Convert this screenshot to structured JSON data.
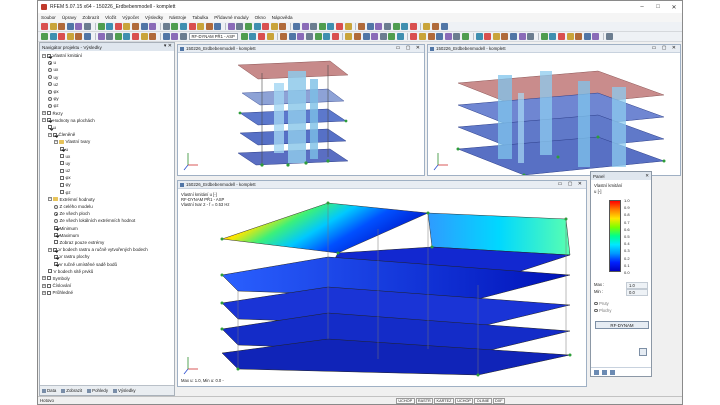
{
  "window": {
    "title": "RFEM 5.07.15 x64 - 150226_Erdbebenmodell - komplett",
    "minimize": "–",
    "maximize": "□",
    "close": "✕"
  },
  "menu": [
    "Soubor",
    "Úpravy",
    "Zobrazit",
    "Vložit",
    "Výpočet",
    "Výsledky",
    "Nástroje",
    "Tabulka",
    "Přídavné moduly",
    "Okno",
    "Nápověda"
  ],
  "toolbar": {
    "combo_case": "RF-DYNAM PŘ1 - ASP"
  },
  "navigator": {
    "title": "Navigátor projektu - Výsledky",
    "controls": "▾ ✕",
    "tabs": [
      "Data",
      "Zobrazit",
      "Pohledy",
      "Výsledky"
    ],
    "tree": [
      {
        "level": 1,
        "type": "check",
        "on": true,
        "expander": "−",
        "label": "Vlastní kmitání"
      },
      {
        "level": 2,
        "type": "radio",
        "on": true,
        "label": "u"
      },
      {
        "level": 2,
        "type": "radio",
        "on": false,
        "label": "ux"
      },
      {
        "level": 2,
        "type": "radio",
        "on": false,
        "label": "uy"
      },
      {
        "level": 2,
        "type": "radio",
        "on": false,
        "label": "uz"
      },
      {
        "level": 2,
        "type": "radio",
        "on": false,
        "label": "φx"
      },
      {
        "level": 2,
        "type": "radio",
        "on": false,
        "label": "φy"
      },
      {
        "level": 2,
        "type": "radio",
        "on": false,
        "label": "φz"
      },
      {
        "level": 1,
        "type": "check",
        "on": false,
        "expander": "+",
        "label": "Řezy"
      },
      {
        "level": 1,
        "type": "check",
        "on": true,
        "expander": "−",
        "label": "Hodnoty na plochách"
      },
      {
        "level": 2,
        "type": "check",
        "on": true,
        "label": "u"
      },
      {
        "level": 2,
        "type": "check",
        "on": true,
        "expander": "−",
        "label": "Členěně"
      },
      {
        "level": 3,
        "type": "folder",
        "on": false,
        "expander": "−",
        "label": "Vlastní tvary"
      },
      {
        "level": 4,
        "type": "check",
        "on": true,
        "label": "u"
      },
      {
        "level": 4,
        "type": "check",
        "on": false,
        "label": "ux"
      },
      {
        "level": 4,
        "type": "check",
        "on": false,
        "label": "uy"
      },
      {
        "level": 4,
        "type": "check",
        "on": false,
        "label": "uz"
      },
      {
        "level": 4,
        "type": "check",
        "on": false,
        "label": "φx"
      },
      {
        "level": 4,
        "type": "check",
        "on": false,
        "label": "φy"
      },
      {
        "level": 4,
        "type": "check",
        "on": false,
        "label": "φz"
      },
      {
        "level": 2,
        "type": "folder",
        "on": false,
        "expander": "−",
        "label": "Extrémní hodnoty"
      },
      {
        "level": 3,
        "type": "radio",
        "on": false,
        "label": "Z celého modelu"
      },
      {
        "level": 3,
        "type": "radio",
        "on": true,
        "label": "Ze všech ploch"
      },
      {
        "level": 3,
        "type": "radio",
        "on": false,
        "label": "Ze všech lokálních extrémních hodnot"
      },
      {
        "level": 3,
        "type": "check",
        "on": true,
        "label": "Minimum"
      },
      {
        "level": 3,
        "type": "check",
        "on": true,
        "label": "Maximum"
      },
      {
        "level": 3,
        "type": "check",
        "on": false,
        "label": "Zobraz pouze extrémy"
      },
      {
        "level": 2,
        "type": "check",
        "on": true,
        "expander": "−",
        "label": "V bodech rastru a ručně vytvořených bodech"
      },
      {
        "level": 3,
        "type": "check",
        "on": true,
        "label": "V rastru plochy"
      },
      {
        "level": 3,
        "type": "check",
        "on": true,
        "label": "V ručně umístěné sadě bodů"
      },
      {
        "level": 2,
        "type": "check",
        "on": false,
        "label": "V bodech sítě prvků"
      },
      {
        "level": 1,
        "type": "check",
        "on": false,
        "expander": "+",
        "label": "Symboly"
      },
      {
        "level": 1,
        "type": "check",
        "on": false,
        "expander": "+",
        "label": "Číslování"
      },
      {
        "level": 1,
        "type": "check",
        "on": false,
        "expander": "+",
        "label": "Průhledné"
      }
    ]
  },
  "views": {
    "top_left_title": "150226_Erdbebenmodell - komplett",
    "top_right_title": "150226_Erdbebenmodell - komplett",
    "main_title": "150226_Erdbebenmodell - komplett",
    "main_info": [
      "Vlastní kmitání u [-]",
      "RF-DYNAM PŘ1 - ASP",
      "Vlastní tvar 2 - f = 0.53 Hz"
    ],
    "main_footer": "Max u: 1.0, Min u: 0.0 -",
    "controls": "▭ ▢ ✕"
  },
  "panel": {
    "title": "Panel",
    "close": "✕",
    "heading": "Vlastní kmitání",
    "unit": "u [-]",
    "legend_values": [
      "1.0",
      "0.9",
      "0.8",
      "0.7",
      "0.6",
      "0.5",
      "0.4",
      "0.3",
      "0.2",
      "0.1",
      "0.0"
    ],
    "max_label": "Max :",
    "max_value": "1.0",
    "min_label": "Min :",
    "min_value": "0.0",
    "option_prutu": "Pruty",
    "option_plochy": "Plochy",
    "button": "RF-DYNAM"
  },
  "status": {
    "text": "Hotovo",
    "keys": [
      "UCHOP",
      "RASTR",
      "KARTEZ",
      "UCHOP",
      "OLINIE",
      "DXF"
    ]
  },
  "colors": {
    "accent": "#5176a6",
    "legend_max": "#ff0000",
    "legend_min": "#0000c0"
  }
}
